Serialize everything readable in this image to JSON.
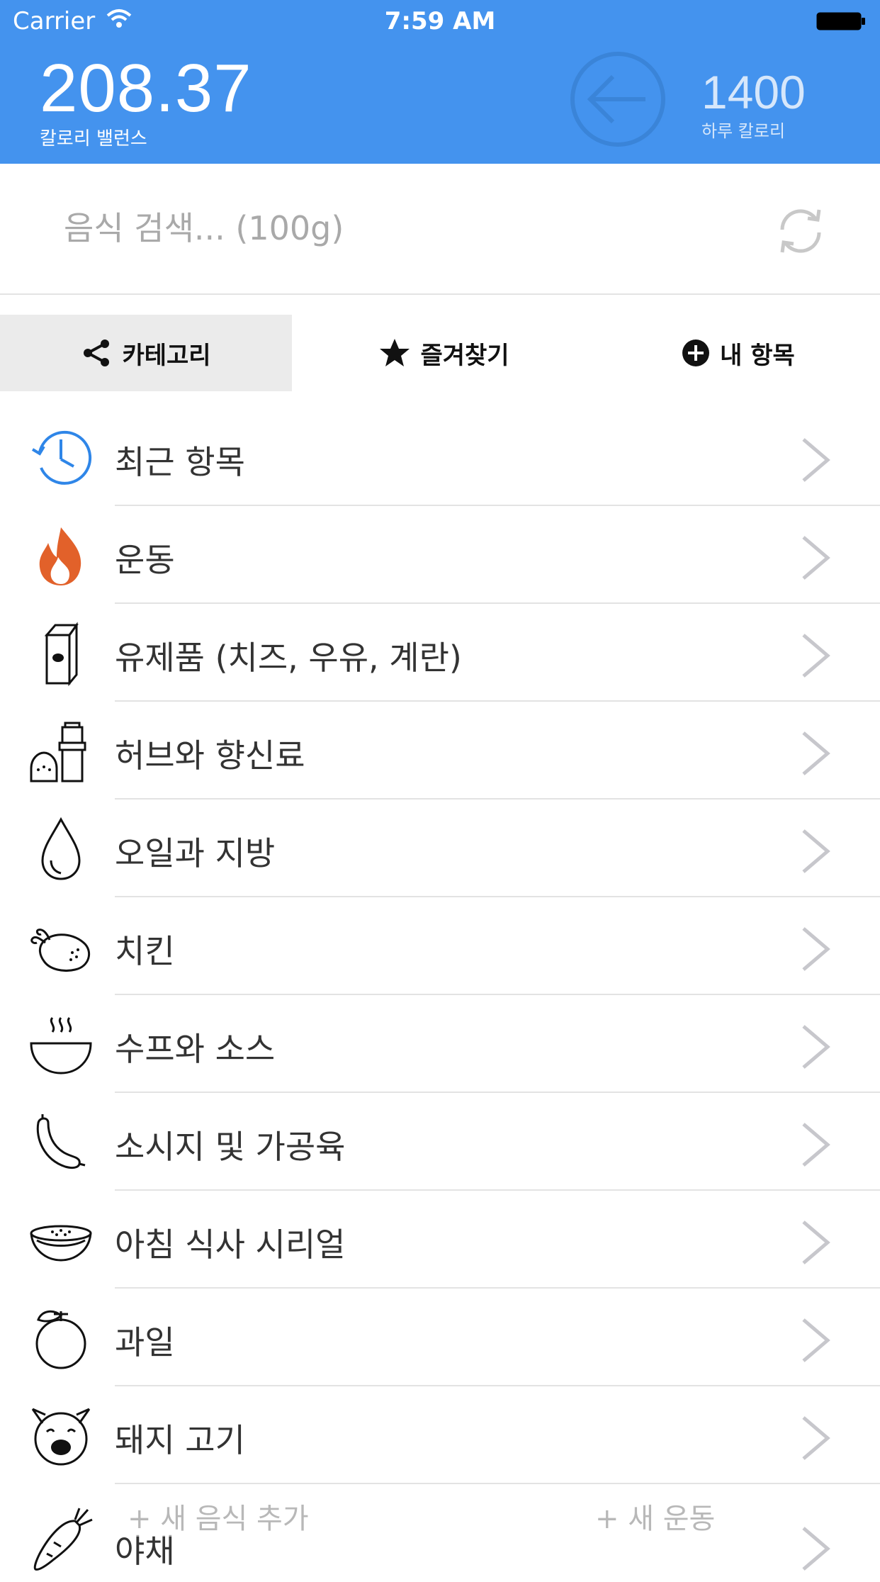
{
  "status_bar": {
    "carrier": "Carrier",
    "time": "7:59 AM"
  },
  "header": {
    "balance_value": "208.37",
    "balance_label": "칼로리 밸런스",
    "daily_value": "1400",
    "daily_label": "하루 칼로리",
    "accent_color": "#4493ee"
  },
  "search": {
    "placeholder": "음식 검색... (100g)"
  },
  "tabs": [
    {
      "label": "카테고리",
      "icon": "share-icon",
      "selected": true
    },
    {
      "label": "즐겨찾기",
      "icon": "star-icon",
      "selected": false
    },
    {
      "label": "내 항목",
      "icon": "plus-circle-icon",
      "selected": false
    }
  ],
  "categories": [
    {
      "label": "최근 항목",
      "icon": "clock-icon"
    },
    {
      "label": "운동",
      "icon": "flame-icon"
    },
    {
      "label": "유제품 (치즈, 우유, 계란)",
      "icon": "milk-carton-icon"
    },
    {
      "label": "허브와 향신료",
      "icon": "spice-grinder-icon"
    },
    {
      "label": "오일과 지방",
      "icon": "oil-drop-icon"
    },
    {
      "label": "치킨",
      "icon": "roast-chicken-icon"
    },
    {
      "label": "수프와 소스",
      "icon": "soup-bowl-icon"
    },
    {
      "label": "소시지 및 가공육",
      "icon": "sausage-icon"
    },
    {
      "label": "아침 식사 시리얼",
      "icon": "cereal-bowl-icon"
    },
    {
      "label": "과일",
      "icon": "orange-fruit-icon"
    },
    {
      "label": "돼지 고기",
      "icon": "pig-icon"
    },
    {
      "label": "야채",
      "icon": "carrot-icon"
    }
  ],
  "bottom_actions": {
    "add_food": "+ 새 음식 추가",
    "add_exercise": "+ 새 운동"
  }
}
